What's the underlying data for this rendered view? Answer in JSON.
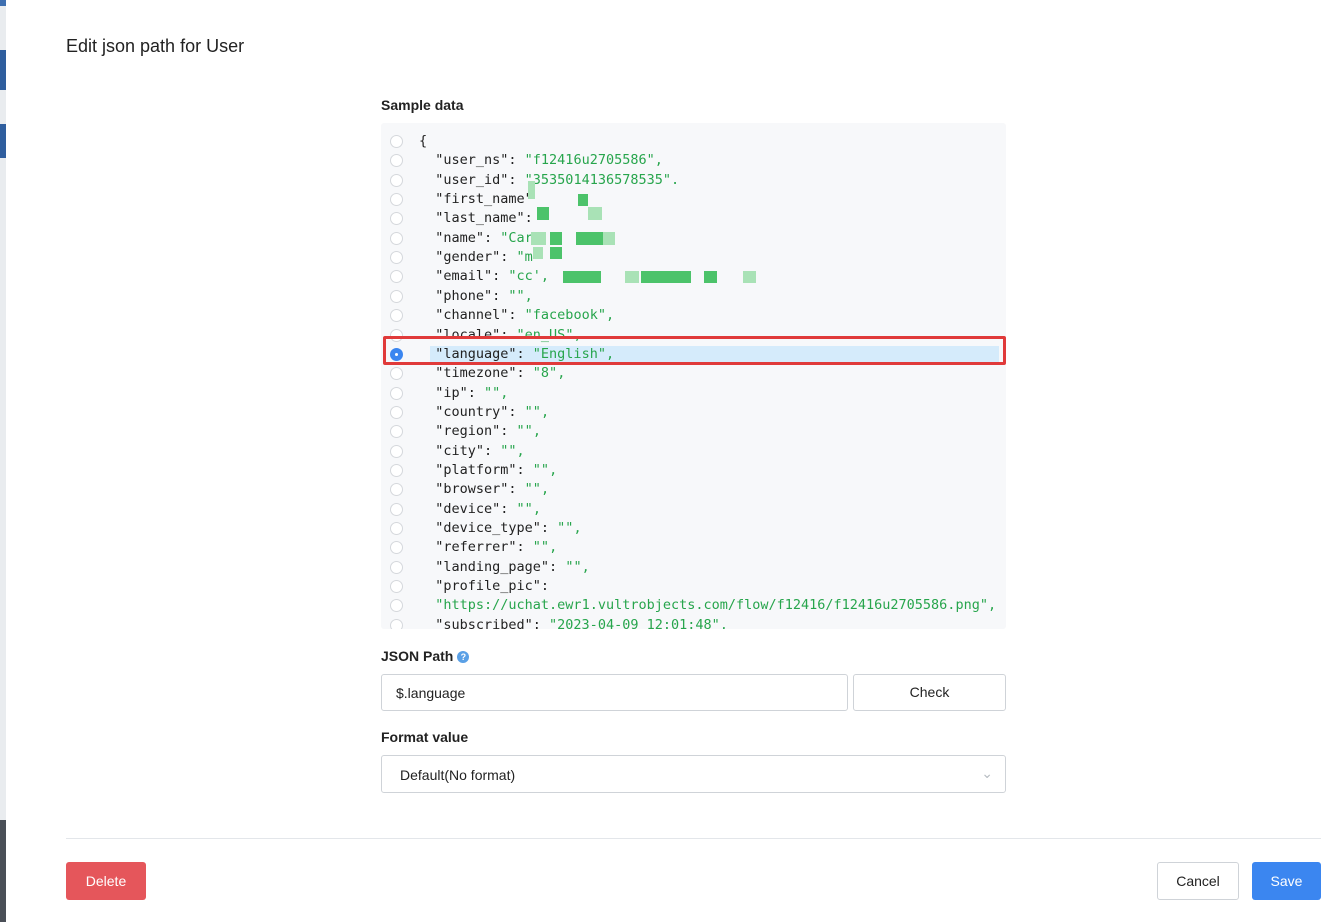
{
  "dialog": {
    "title": "Edit json path for User"
  },
  "sample": {
    "label": "Sample data",
    "lines": [
      {
        "key": "{",
        "val": "",
        "suffix": ""
      },
      {
        "key": "  \"user_ns\": ",
        "val": "\"f12416u2705586\"",
        "suffix": ","
      },
      {
        "key": "  \"user_id\": ",
        "val": "\"3535014136578535\"",
        "suffix": "."
      },
      {
        "key": "  \"first_name\"",
        "val": "",
        "suffix": ""
      },
      {
        "key": "  \"last_name\": ",
        "val": "",
        "suffix": ""
      },
      {
        "key": "  \"name\": ",
        "val": "\"Car",
        "suffix": ""
      },
      {
        "key": "  \"gender\": ",
        "val": "\"m",
        "suffix": ""
      },
      {
        "key": "  \"email\": ",
        "val": "\"cc",
        "suffix": "',"
      },
      {
        "key": "  \"phone\": ",
        "val": "\"\"",
        "suffix": ","
      },
      {
        "key": "  \"channel\": ",
        "val": "\"facebook\"",
        "suffix": ","
      },
      {
        "key": "  \"locale\": ",
        "val": "\"en_US\"",
        "suffix": ","
      },
      {
        "key": "  \"language\": ",
        "val": "\"English\"",
        "suffix": ","
      },
      {
        "key": "  \"timezone\": ",
        "val": "\"8\"",
        "suffix": ","
      },
      {
        "key": "  \"ip\": ",
        "val": "\"\"",
        "suffix": ","
      },
      {
        "key": "  \"country\": ",
        "val": "\"\"",
        "suffix": ","
      },
      {
        "key": "  \"region\": ",
        "val": "\"\"",
        "suffix": ","
      },
      {
        "key": "  \"city\": ",
        "val": "\"\"",
        "suffix": ","
      },
      {
        "key": "  \"platform\": ",
        "val": "\"\"",
        "suffix": ","
      },
      {
        "key": "  \"browser\": ",
        "val": "\"\"",
        "suffix": ","
      },
      {
        "key": "  \"device\": ",
        "val": "\"\"",
        "suffix": ","
      },
      {
        "key": "  \"device_type\": ",
        "val": "\"\"",
        "suffix": ","
      },
      {
        "key": "  \"referrer\": ",
        "val": "\"\"",
        "suffix": ","
      },
      {
        "key": "  \"landing_page\": ",
        "val": "\"\"",
        "suffix": ","
      },
      {
        "key": "  \"profile_pic\":",
        "val": "",
        "suffix": ""
      },
      {
        "key": "  ",
        "val": "\"https://uchat.ewr1.vultrobjects.com/flow/f12416/f12416u2705586.png\"",
        "suffix": ","
      },
      {
        "key": "  \"subscribed\": ",
        "val": "\"2023-04-09 12:01:48\"",
        "suffix": ","
      }
    ],
    "selected_index": 11
  },
  "json_path": {
    "label": "JSON Path",
    "help_icon": "?",
    "value": "$.language",
    "check_label": "Check"
  },
  "format": {
    "label": "Format value",
    "selected": "Default(No format)"
  },
  "footer": {
    "delete_label": "Delete",
    "cancel_label": "Cancel",
    "save_label": "Save"
  },
  "colors": {
    "accent": "#3b86f0",
    "danger": "#e5565b",
    "string_value": "#27a54c",
    "selected_row": "#d5ebfb",
    "highlight_border": "#e03a3a"
  }
}
